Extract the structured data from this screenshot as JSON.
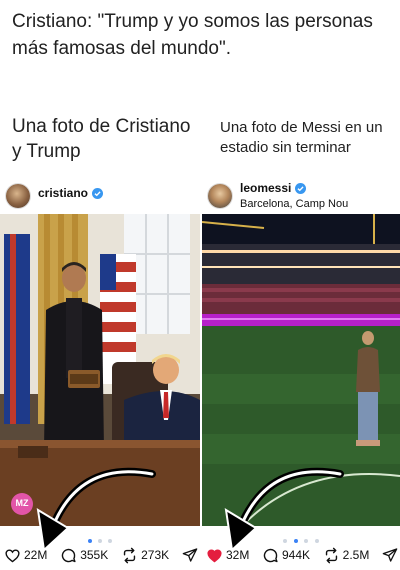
{
  "headline": "Cristiano: \"Trump y yo somos las personas más famosas del mundo\".",
  "captions": {
    "left": "Una foto de Cristiano y Trump",
    "right": "Una foto de Messi en un estadio sin terminar"
  },
  "posts": [
    {
      "username": "cristiano",
      "verified": true,
      "location": "",
      "watermark": "MZ",
      "likes": "22M",
      "liked": false,
      "comments": "355K",
      "reposts": "273K",
      "carousel_active": 1,
      "carousel_total": 3
    },
    {
      "username": "leomessi",
      "verified": true,
      "location": "Barcelona, Camp Nou",
      "likes": "32M",
      "liked": true,
      "comments": "944K",
      "reposts": "2.5M",
      "carousel_active": 2,
      "carousel_total": 4
    }
  ],
  "colors": {
    "verified": "#3897f0",
    "liked_heart": "#e41e3f",
    "arrow": "#000000",
    "pitch_purple": "#b620c9"
  },
  "icons": [
    "heart-icon",
    "comment-icon",
    "repost-icon",
    "share-icon",
    "verified-badge-icon",
    "arrow-overlay"
  ]
}
